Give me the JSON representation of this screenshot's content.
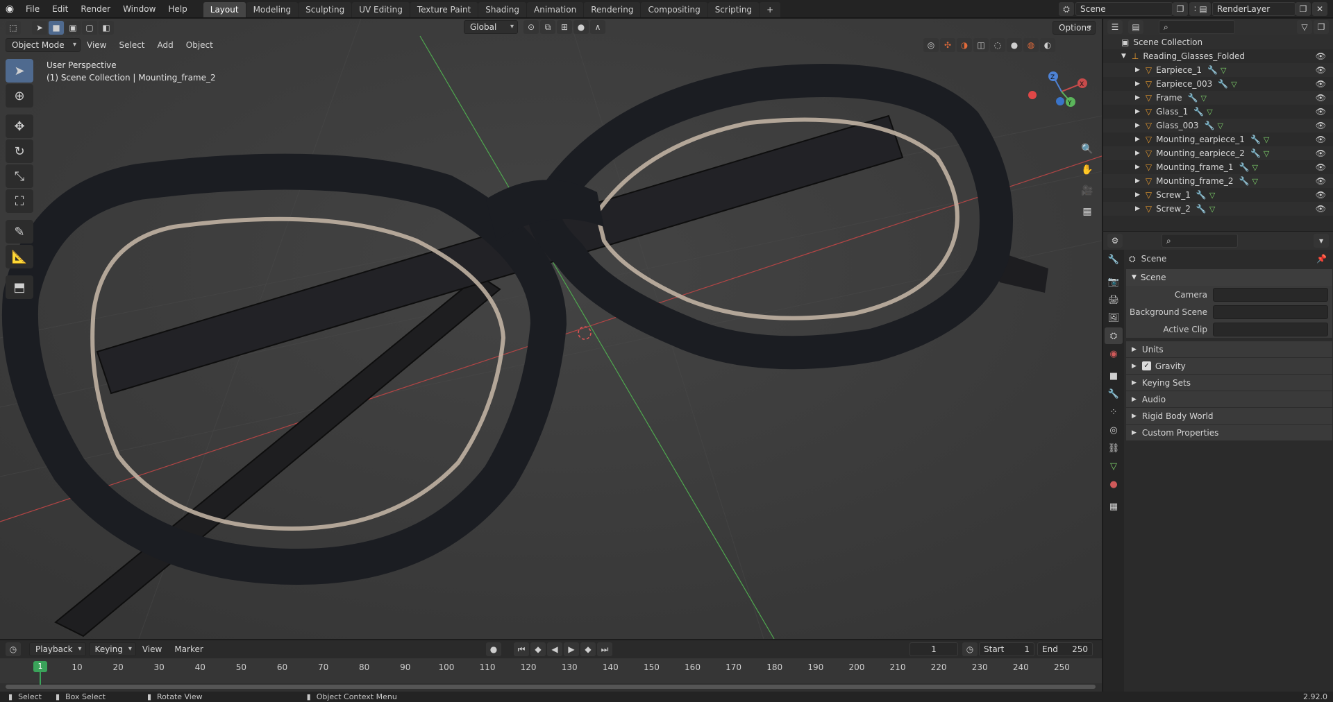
{
  "topbar": {
    "menus": [
      "File",
      "Edit",
      "Render",
      "Window",
      "Help"
    ],
    "workspaces": [
      "Layout",
      "Modeling",
      "Sculpting",
      "UV Editing",
      "Texture Paint",
      "Shading",
      "Animation",
      "Rendering",
      "Compositing",
      "Scripting"
    ],
    "active_workspace": "Layout",
    "add_tab": "+",
    "scene_name": "Scene",
    "view_layer": "RenderLayer"
  },
  "viewport": {
    "mode": "Object Mode",
    "menus": [
      "View",
      "Select",
      "Add",
      "Object"
    ],
    "transform_orientation": "Global",
    "options_label": "Options",
    "overlay_title": "User Perspective",
    "overlay_subtitle": "(1) Scene Collection | Mounting_frame_2",
    "gizmo": {
      "x_label": "X",
      "y_label": "Y",
      "z_label": "Z"
    }
  },
  "timeline": {
    "menus": [
      "Playback",
      "Keying",
      "View",
      "Marker"
    ],
    "current_frame": "1",
    "start_label": "Start",
    "start_value": "1",
    "end_label": "End",
    "end_value": "250",
    "ruler_ticks": [
      "1",
      "10",
      "20",
      "30",
      "40",
      "50",
      "60",
      "70",
      "80",
      "90",
      "100",
      "110",
      "120",
      "130",
      "140",
      "150",
      "160",
      "170",
      "180",
      "190",
      "200",
      "210",
      "220",
      "230",
      "240",
      "250"
    ]
  },
  "statusbar": {
    "select": "Select",
    "box_select": "Box Select",
    "rotate_view": "Rotate View",
    "context_menu": "Object Context Menu",
    "version": "2.92.0"
  },
  "outliner": {
    "root": "Scene Collection",
    "collection": "Reading_Glasses_Folded",
    "objects": [
      "Earpiece_1",
      "Earpiece_003",
      "Frame",
      "Glass_1",
      "Glass_003",
      "Mounting_earpiece_1",
      "Mounting_earpiece_2",
      "Mounting_frame_1",
      "Mounting_frame_2",
      "Screw_1",
      "Screw_2"
    ]
  },
  "properties": {
    "context": "Scene",
    "panel_title": "Scene",
    "camera_label": "Camera",
    "background_scene_label": "Background Scene",
    "active_clip_label": "Active Clip",
    "subpanels": [
      "Units",
      "Gravity",
      "Keying Sets",
      "Audio",
      "Rigid Body World",
      "Custom Properties"
    ]
  },
  "colors": {
    "accent": "#4f6a8f",
    "object_orange": "#e0962e",
    "frame_green": "#3aa35a",
    "axis_red": "#c84b4b",
    "axis_green": "#5bb55b"
  }
}
